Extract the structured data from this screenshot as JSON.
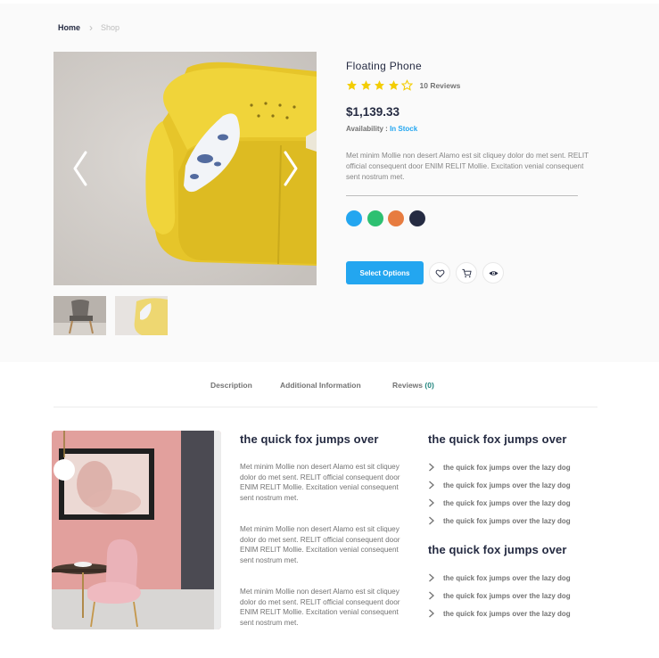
{
  "breadcrumb": {
    "home": "Home",
    "current": "Shop"
  },
  "product": {
    "title": "Floating Phone",
    "rating": 4,
    "max_rating": 5,
    "reviews_count": "10 Reviews",
    "price": "$1,139.33",
    "availability_label": "Availability",
    "availability_sep": " : ",
    "availability_value": "In Stock",
    "description": "Met minim Mollie non desert Alamo est sit cliquey dolor do met sent. RELIT official consequent door ENIM RELIT Mollie. Excitation venial consequent sent nostrum met.",
    "colors": [
      "#23a6f0",
      "#2dc071",
      "#e77c40",
      "#252b42"
    ],
    "select_options_label": "Select Options",
    "action_icons": [
      "heart-icon",
      "cart-icon",
      "eye-icon"
    ]
  },
  "tabs": {
    "description": "Description",
    "additional": "Additional Information",
    "reviews": "Reviews",
    "reviews_count": "(0)"
  },
  "content": {
    "middle_title": "the quick fox jumps over",
    "paragraphs": [
      "Met minim Mollie non desert Alamo est sit cliquey dolor do met sent. RELIT official consequent door ENIM RELIT Mollie. Excitation venial consequent sent nostrum met.",
      "Met minim Mollie non desert Alamo est sit cliquey dolor do met sent. RELIT official consequent door ENIM RELIT Mollie. Excitation venial consequent sent nostrum met.",
      "Met minim Mollie non desert Alamo est sit cliquey dolor do met sent. RELIT official consequent door ENIM RELIT Mollie. Excitation venial consequent sent nostrum met."
    ],
    "right_title_1": "the quick fox jumps over",
    "list_1": [
      "the quick fox jumps over the lazy dog",
      "the quick fox jumps over the lazy dog",
      "the quick fox jumps over the lazy dog",
      "the quick fox jumps over the lazy dog"
    ],
    "right_title_2": "the quick fox jumps over",
    "list_2": [
      "the quick fox jumps over the lazy dog",
      "the quick fox jumps over the lazy dog",
      "the quick fox jumps over the lazy dog"
    ]
  }
}
